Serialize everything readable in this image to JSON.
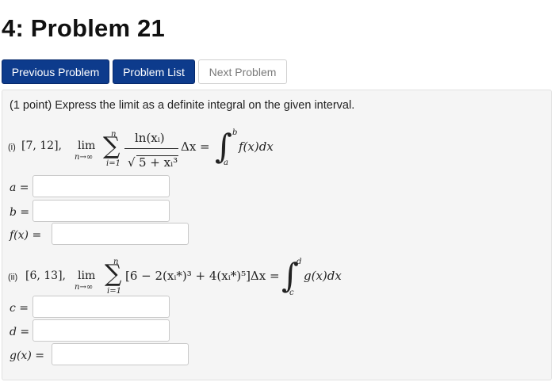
{
  "header": {
    "title": "4: Problem 21"
  },
  "nav": {
    "previous_label": "Previous Problem",
    "list_label": "Problem List",
    "next_label": "Next Problem"
  },
  "problem": {
    "intro": "(1 point) Express the limit as a definite integral on the given interval.",
    "part1": {
      "label": "(i)",
      "interval": "[7, 12],",
      "lim": "lim",
      "lim_sub": "n→∞",
      "sum_top": "n",
      "sum_bottom": "i=1",
      "numerator": "ln(xᵢ)",
      "denominator": "5 + xᵢ³",
      "delta": "Δx =",
      "int_top": "b",
      "int_bottom": "a",
      "integrand": "f(x)dx",
      "fields": [
        {
          "label": "a =",
          "value": ""
        },
        {
          "label": "b =",
          "value": ""
        },
        {
          "label": "f(x) =",
          "value": ""
        }
      ]
    },
    "part2": {
      "label": "(ii)",
      "interval": "[6, 13],",
      "lim": "lim",
      "lim_sub": "n→∞",
      "sum_top": "n",
      "sum_bottom": "i=1",
      "summand": "[6 − 2(xᵢ*)³ + 4(xᵢ*)⁵]Δx =",
      "int_top": "d",
      "int_bottom": "c",
      "integrand": "g(x)dx",
      "fields": [
        {
          "label": "c =",
          "value": ""
        },
        {
          "label": "d =",
          "value": ""
        },
        {
          "label": "g(x) =",
          "value": ""
        }
      ]
    }
  }
}
